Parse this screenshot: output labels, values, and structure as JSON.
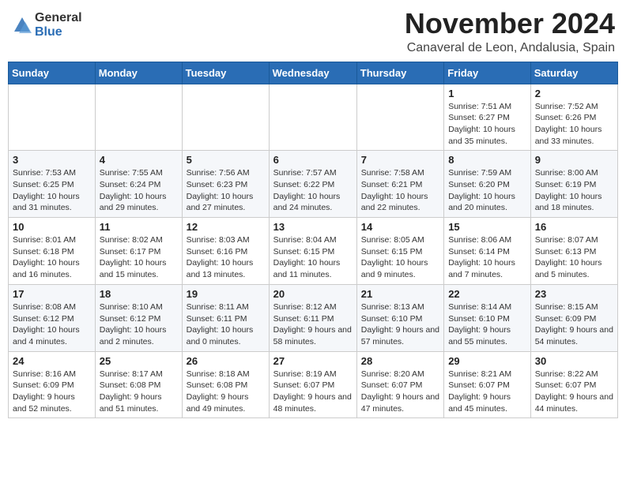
{
  "header": {
    "logo_general": "General",
    "logo_blue": "Blue",
    "month_title": "November 2024",
    "location": "Canaveral de Leon, Andalusia, Spain"
  },
  "days_of_week": [
    "Sunday",
    "Monday",
    "Tuesday",
    "Wednesday",
    "Thursday",
    "Friday",
    "Saturday"
  ],
  "weeks": [
    [
      {
        "day": "",
        "info": ""
      },
      {
        "day": "",
        "info": ""
      },
      {
        "day": "",
        "info": ""
      },
      {
        "day": "",
        "info": ""
      },
      {
        "day": "",
        "info": ""
      },
      {
        "day": "1",
        "info": "Sunrise: 7:51 AM\nSunset: 6:27 PM\nDaylight: 10 hours and 35 minutes."
      },
      {
        "day": "2",
        "info": "Sunrise: 7:52 AM\nSunset: 6:26 PM\nDaylight: 10 hours and 33 minutes."
      }
    ],
    [
      {
        "day": "3",
        "info": "Sunrise: 7:53 AM\nSunset: 6:25 PM\nDaylight: 10 hours and 31 minutes."
      },
      {
        "day": "4",
        "info": "Sunrise: 7:55 AM\nSunset: 6:24 PM\nDaylight: 10 hours and 29 minutes."
      },
      {
        "day": "5",
        "info": "Sunrise: 7:56 AM\nSunset: 6:23 PM\nDaylight: 10 hours and 27 minutes."
      },
      {
        "day": "6",
        "info": "Sunrise: 7:57 AM\nSunset: 6:22 PM\nDaylight: 10 hours and 24 minutes."
      },
      {
        "day": "7",
        "info": "Sunrise: 7:58 AM\nSunset: 6:21 PM\nDaylight: 10 hours and 22 minutes."
      },
      {
        "day": "8",
        "info": "Sunrise: 7:59 AM\nSunset: 6:20 PM\nDaylight: 10 hours and 20 minutes."
      },
      {
        "day": "9",
        "info": "Sunrise: 8:00 AM\nSunset: 6:19 PM\nDaylight: 10 hours and 18 minutes."
      }
    ],
    [
      {
        "day": "10",
        "info": "Sunrise: 8:01 AM\nSunset: 6:18 PM\nDaylight: 10 hours and 16 minutes."
      },
      {
        "day": "11",
        "info": "Sunrise: 8:02 AM\nSunset: 6:17 PM\nDaylight: 10 hours and 15 minutes."
      },
      {
        "day": "12",
        "info": "Sunrise: 8:03 AM\nSunset: 6:16 PM\nDaylight: 10 hours and 13 minutes."
      },
      {
        "day": "13",
        "info": "Sunrise: 8:04 AM\nSunset: 6:15 PM\nDaylight: 10 hours and 11 minutes."
      },
      {
        "day": "14",
        "info": "Sunrise: 8:05 AM\nSunset: 6:15 PM\nDaylight: 10 hours and 9 minutes."
      },
      {
        "day": "15",
        "info": "Sunrise: 8:06 AM\nSunset: 6:14 PM\nDaylight: 10 hours and 7 minutes."
      },
      {
        "day": "16",
        "info": "Sunrise: 8:07 AM\nSunset: 6:13 PM\nDaylight: 10 hours and 5 minutes."
      }
    ],
    [
      {
        "day": "17",
        "info": "Sunrise: 8:08 AM\nSunset: 6:12 PM\nDaylight: 10 hours and 4 minutes."
      },
      {
        "day": "18",
        "info": "Sunrise: 8:10 AM\nSunset: 6:12 PM\nDaylight: 10 hours and 2 minutes."
      },
      {
        "day": "19",
        "info": "Sunrise: 8:11 AM\nSunset: 6:11 PM\nDaylight: 10 hours and 0 minutes."
      },
      {
        "day": "20",
        "info": "Sunrise: 8:12 AM\nSunset: 6:11 PM\nDaylight: 9 hours and 58 minutes."
      },
      {
        "day": "21",
        "info": "Sunrise: 8:13 AM\nSunset: 6:10 PM\nDaylight: 9 hours and 57 minutes."
      },
      {
        "day": "22",
        "info": "Sunrise: 8:14 AM\nSunset: 6:10 PM\nDaylight: 9 hours and 55 minutes."
      },
      {
        "day": "23",
        "info": "Sunrise: 8:15 AM\nSunset: 6:09 PM\nDaylight: 9 hours and 54 minutes."
      }
    ],
    [
      {
        "day": "24",
        "info": "Sunrise: 8:16 AM\nSunset: 6:09 PM\nDaylight: 9 hours and 52 minutes."
      },
      {
        "day": "25",
        "info": "Sunrise: 8:17 AM\nSunset: 6:08 PM\nDaylight: 9 hours and 51 minutes."
      },
      {
        "day": "26",
        "info": "Sunrise: 8:18 AM\nSunset: 6:08 PM\nDaylight: 9 hours and 49 minutes."
      },
      {
        "day": "27",
        "info": "Sunrise: 8:19 AM\nSunset: 6:07 PM\nDaylight: 9 hours and 48 minutes."
      },
      {
        "day": "28",
        "info": "Sunrise: 8:20 AM\nSunset: 6:07 PM\nDaylight: 9 hours and 47 minutes."
      },
      {
        "day": "29",
        "info": "Sunrise: 8:21 AM\nSunset: 6:07 PM\nDaylight: 9 hours and 45 minutes."
      },
      {
        "day": "30",
        "info": "Sunrise: 8:22 AM\nSunset: 6:07 PM\nDaylight: 9 hours and 44 minutes."
      }
    ]
  ]
}
